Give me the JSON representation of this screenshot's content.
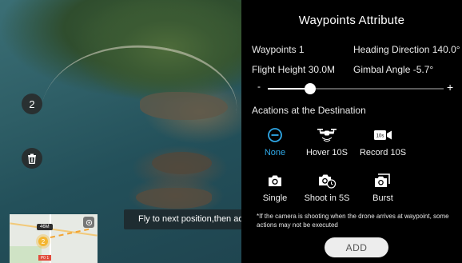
{
  "map": {
    "waypoint_count": "2",
    "altitude_tag": "46M",
    "marker_number": "2",
    "red_tag": "P0 1"
  },
  "toast": "Fly to next position,then add",
  "panel": {
    "title": "Waypoints Attribute",
    "waypoint": "Waypoints 1",
    "heading": "Heading Direction 140.0°",
    "flight_height": "Flight Height 30.0M",
    "gimbal": "Gimbal Angle -5.7°",
    "slider_minus": "-",
    "slider_plus": "+",
    "slider_value_fraction": 0.24,
    "section_title": "Acations at the Destination",
    "actions": [
      {
        "label": "None",
        "icon": "none-icon",
        "selected": true
      },
      {
        "label": "Hover 10S",
        "icon": "hover-drone-icon",
        "selected": false
      },
      {
        "label": "Record 10S",
        "icon": "record-video-icon",
        "selected": false
      },
      {
        "label": "Single",
        "icon": "camera-single-icon",
        "selected": false
      },
      {
        "label": "Shoot in 5S",
        "icon": "camera-timer-icon",
        "selected": false
      },
      {
        "label": "Burst",
        "icon": "camera-burst-icon",
        "selected": false
      }
    ],
    "record_badge": "10s",
    "note": "*If the camera is shooting when the drone arrives at waypoint, some actions may not be executed",
    "add_label": "ADD"
  },
  "colors": {
    "accent": "#2fa7e6",
    "panel_bg": "#000000",
    "map_marker": "#f4b631",
    "map_path": "#f3a534"
  }
}
